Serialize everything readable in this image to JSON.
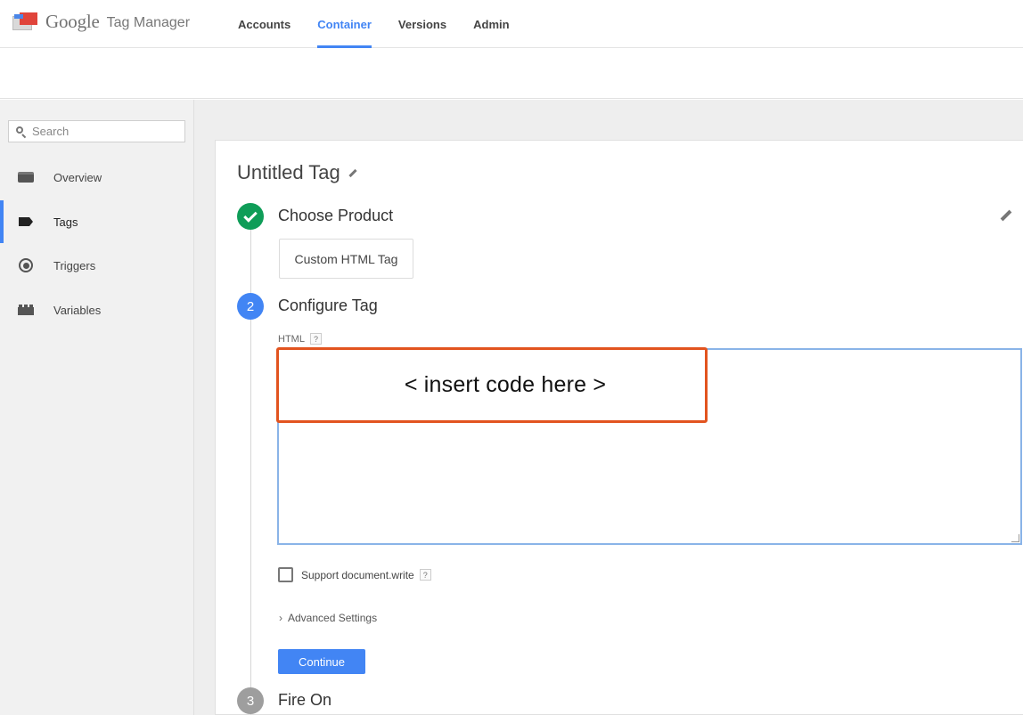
{
  "app": {
    "logo_google": "Google",
    "logo_product": "Tag Manager"
  },
  "nav": {
    "tabs": [
      {
        "label": "Accounts"
      },
      {
        "label": "Container",
        "active": true
      },
      {
        "label": "Versions"
      },
      {
        "label": "Admin"
      }
    ]
  },
  "sidebar": {
    "search_placeholder": "Search",
    "items": [
      {
        "label": "Overview",
        "icon": "overview-icon"
      },
      {
        "label": "Tags",
        "icon": "tag-icon",
        "active": true
      },
      {
        "label": "Triggers",
        "icon": "trigger-icon"
      },
      {
        "label": "Variables",
        "icon": "variables-icon"
      }
    ]
  },
  "editor": {
    "title": "Untitled Tag",
    "steps": [
      {
        "number": "1",
        "title": "Choose Product",
        "status": "done"
      },
      {
        "number": "2",
        "title": "Configure Tag",
        "status": "active"
      },
      {
        "number": "3",
        "title": "Fire On",
        "status": "pending"
      }
    ],
    "product": "Custom HTML Tag",
    "html_label": "HTML",
    "help_glyph": "?",
    "code_value": "",
    "overlay_text": "< insert code here >",
    "support_label": "Support document.write",
    "support_checked": false,
    "advanced_label": "Advanced Settings",
    "advanced_chevron": "›",
    "continue_label": "Continue"
  },
  "colors": {
    "accent": "#4285f4",
    "success": "#0f9d58",
    "highlight_border": "#e2541f"
  }
}
